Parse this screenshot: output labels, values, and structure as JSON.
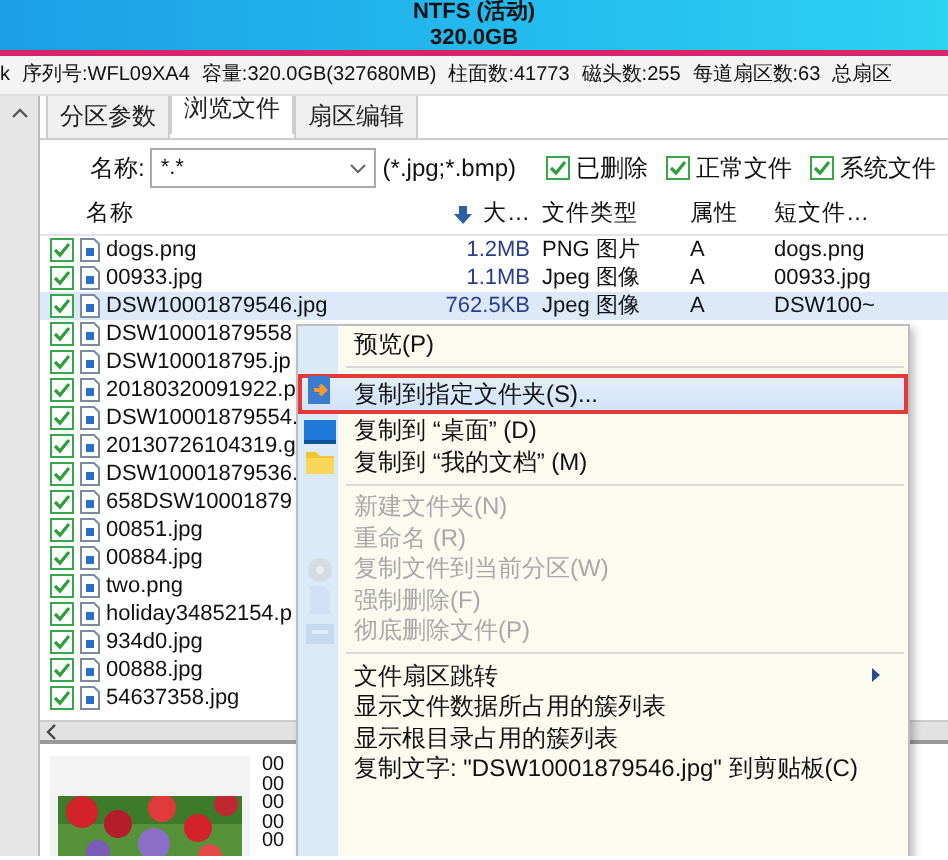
{
  "title": {
    "line_1": "NTFS (活动)",
    "line_2": "320.0GB"
  },
  "disk_info": [
    "k",
    "序列号:WFL09XA4",
    "容量:320.0GB(327680MB)",
    "柱面数:41773",
    "磁头数:255",
    "每道扇区数:63",
    "总扇区"
  ],
  "tabs": [
    {
      "label": "分区参数",
      "selected": false
    },
    {
      "label": "浏览文件",
      "selected": true
    },
    {
      "label": "扇区编辑",
      "selected": false
    }
  ],
  "filter": {
    "label": "名称:",
    "value": "*.*",
    "hint": "(*.jpg;*.bmp)",
    "options": [
      {
        "label": "已删除",
        "checked": true
      },
      {
        "label": "正常文件",
        "checked": true
      },
      {
        "label": "系统文件",
        "checked": true
      }
    ]
  },
  "table": {
    "columns": [
      "名称",
      "大…",
      "文件类型",
      "属性",
      "短文件…"
    ],
    "rows": [
      {
        "name": "dogs.png",
        "size": "1.2MB",
        "type": "PNG 图片",
        "attr": "A",
        "short": "dogs.png",
        "checked": true,
        "selected": false
      },
      {
        "name": "00933.jpg",
        "size": "1.1MB",
        "type": "Jpeg 图像",
        "attr": "A",
        "short": "00933.jpg",
        "checked": true,
        "selected": false
      },
      {
        "name": "DSW10001879546.jpg",
        "size": "762.5KB",
        "type": "Jpeg 图像",
        "attr": "A",
        "short": "DSW100~",
        "checked": true,
        "selected": true
      },
      {
        "name": "DSW10001879558",
        "checked": true,
        "selected": false
      },
      {
        "name": "DSW100018795.jp",
        "checked": true,
        "selected": false
      },
      {
        "name": "20180320091922.p",
        "checked": true,
        "selected": false
      },
      {
        "name": "DSW10001879554.",
        "checked": true,
        "selected": false
      },
      {
        "name": "20130726104319.g",
        "checked": true,
        "selected": false
      },
      {
        "name": "DSW10001879536.",
        "checked": true,
        "selected": false
      },
      {
        "name": "658DSW10001879",
        "checked": true,
        "selected": false
      },
      {
        "name": "00851.jpg",
        "checked": true,
        "selected": false
      },
      {
        "name": "00884.jpg",
        "checked": true,
        "selected": false
      },
      {
        "name": "two.png",
        "checked": true,
        "selected": false
      },
      {
        "name": "holiday34852154.p",
        "checked": true,
        "selected": false
      },
      {
        "name": "934d0.jpg",
        "checked": true,
        "selected": false
      },
      {
        "name": "00888.jpg",
        "checked": true,
        "selected": false
      },
      {
        "name": "54637358.jpg",
        "checked": true,
        "selected": false
      }
    ]
  },
  "preview": {
    "kind": "picture",
    "hex": [
      "00",
      "00",
      "00",
      "00",
      "00"
    ]
  },
  "context_menu": [
    {
      "kind": "item",
      "label": "预览(P)",
      "disabled": false,
      "highlighted": false
    },
    {
      "kind": "separator"
    },
    {
      "kind": "item",
      "label": "复制到指定文件夹(S)...",
      "disabled": false,
      "highlighted": true
    },
    {
      "kind": "item",
      "label": "复制到 “桌面” (D)",
      "disabled": false,
      "highlighted": false
    },
    {
      "kind": "item",
      "label": "复制到 “我的文档” (M)",
      "disabled": false,
      "highlighted": false
    },
    {
      "kind": "separator"
    },
    {
      "kind": "item",
      "label": "新建文件夹(N)",
      "disabled": true,
      "highlighted": false
    },
    {
      "kind": "item",
      "label": "重命名 (R)",
      "disabled": true,
      "highlighted": false
    },
    {
      "kind": "item",
      "label": "复制文件到当前分区(W)",
      "disabled": true,
      "highlighted": false
    },
    {
      "kind": "item",
      "label": "强制删除(F)",
      "disabled": true,
      "highlighted": false
    },
    {
      "kind": "item",
      "label": "彻底删除文件(P)",
      "disabled": true,
      "highlighted": false
    },
    {
      "kind": "separator"
    },
    {
      "kind": "item",
      "label": "文件扇区跳转",
      "submenu": true,
      "disabled": false,
      "highlighted": false
    },
    {
      "kind": "item",
      "label": "显示文件数据所占用的簇列表",
      "disabled": false,
      "highlighted": false
    },
    {
      "kind": "item",
      "label": "显示根目录占用的簇列表",
      "disabled": false,
      "highlighted": false
    },
    {
      "kind": "item",
      "label": "复制文字: \"DSW10001879546.jpg\" 到剪贴板(C)",
      "disabled": false,
      "highlighted": false
    }
  ]
}
